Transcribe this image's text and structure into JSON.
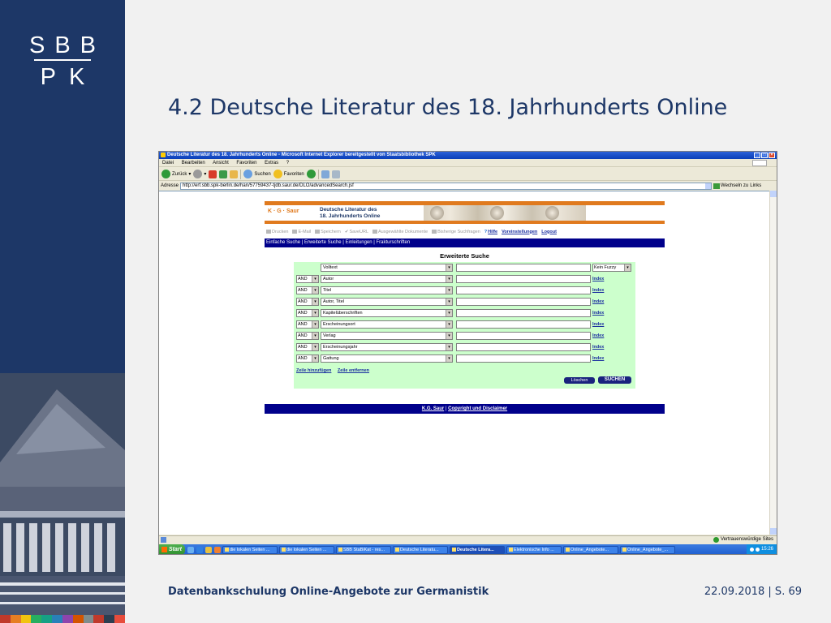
{
  "logo": {
    "line1": "SBB",
    "line2": "PK"
  },
  "slide": {
    "title": "4.2 Deutsche Literatur des 18. Jahrhunderts Online",
    "footer_left": "Datenbankschulung Online-Angebote zur Germanistik",
    "footer_right": "22.09.2018 | S. 69"
  },
  "colors": {
    "band": "#1d3767",
    "strip": [
      "#c0392b",
      "#e67e22",
      "#f1c40f",
      "#27ae60",
      "#16a085",
      "#2980b9",
      "#8e44ad",
      "#d35400",
      "#7f8c8d",
      "#c0392b",
      "#2c3e50",
      "#e74c3c"
    ]
  },
  "browser": {
    "title": "Deutsche Literatur des 18. Jahrhunderts Online - Microsoft Internet Explorer bereitgestellt von Staatsbibliothek SPK",
    "menu": [
      "Datei",
      "Bearbeiten",
      "Ansicht",
      "Favoriten",
      "Extras",
      "?"
    ],
    "toolbar": {
      "back": "Zurück",
      "search": "Suchen",
      "favorites": "Favoriten"
    },
    "address_label": "Adresse",
    "url": "http://erf.sbb.spk-berlin.de/han/57759437-tjdb.saur.de/DLO/advancedSearch.jsf",
    "go_label": "Wechseln zu",
    "links_label": "Links",
    "status_zone": "Vertrauenswürdige Sites"
  },
  "site": {
    "brand": "K · G · Saur",
    "db_title_1": "Deutsche Literatur des",
    "db_title_2": "18. Jahrhunderts Online",
    "tools": {
      "print": "Drucken",
      "email": "E-Mail",
      "save": "Speichern",
      "save_url": "SaveURL",
      "selected_docs": "Ausgewählte Dokumente",
      "previous_searches": "Bisherige Suchfragen",
      "help": "Hilfe",
      "preferences": "Voreinstellungen",
      "logout": "Logout"
    },
    "nav": {
      "simple": "Einfache Suche",
      "advanced": "Erweiterte Suche",
      "intro": "Einleitungen",
      "fraktur": "Frakturschriften"
    },
    "search_title": "Erweiterte Suche",
    "first_row": {
      "field": "Volltext",
      "fuzzy": "Kein Fuzzy"
    },
    "rows": [
      {
        "op": "AND",
        "field": "Autor",
        "index": "Index"
      },
      {
        "op": "AND",
        "field": "Titel",
        "index": "Index"
      },
      {
        "op": "AND",
        "field": "Autor, Titel",
        "index": "Index"
      },
      {
        "op": "AND",
        "field": "Kapitelüberschriften",
        "index": "Index"
      },
      {
        "op": "AND",
        "field": "Erscheinungsort",
        "index": "Index"
      },
      {
        "op": "AND",
        "field": "Verlag",
        "index": "Index"
      },
      {
        "op": "AND",
        "field": "Erscheinungsjahr",
        "index": "Index"
      },
      {
        "op": "AND",
        "field": "Gattung",
        "index": "Index"
      }
    ],
    "add_row": "Zeile hinzufügen",
    "remove_row": "Zeile entfernen",
    "clear_btn": "Löschen",
    "search_btn": "SUCHEN",
    "footer_saur": "K.G. Saur",
    "footer_sep": "|",
    "footer_copyright": "Copyright und Disclaimer"
  },
  "taskbar": {
    "start": "Start",
    "tasks": [
      "die lokalen Seiten ...",
      "die lokalen Seiten ...",
      "SBB StaBiKat - res...",
      "Deutsche Literatu...",
      "Deutsche Litera...",
      "Elektronische Info ...",
      "Online_Angebote...",
      "Online_Angebote_..."
    ],
    "active_index": 4,
    "time": "15:26"
  }
}
